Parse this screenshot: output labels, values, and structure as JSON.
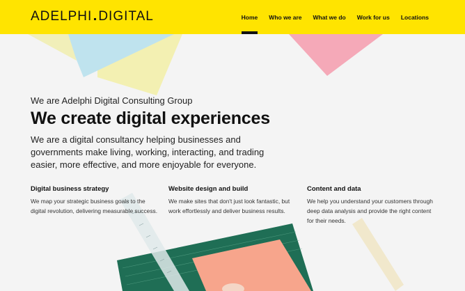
{
  "header": {
    "logo_left": "ADELPHI",
    "logo_right": "DIGITAL",
    "nav": [
      {
        "label": "Home",
        "active": true
      },
      {
        "label": "Who we are",
        "active": false
      },
      {
        "label": "What we do",
        "active": false
      },
      {
        "label": "Work for us",
        "active": false
      },
      {
        "label": "Locations",
        "active": false
      }
    ]
  },
  "hero": {
    "kicker": "We are Adelphi Digital Consulting Group",
    "title": "We create digital experiences",
    "lead": "We are a digital consultancy helping businesses and governments make living, working, interacting, and trading easier, more effective, and more enjoyable for everyone."
  },
  "services": [
    {
      "title": "Digital business strategy",
      "text": "We map your strategic business goals to the digital revolution, delivering measurable success."
    },
    {
      "title": "Website design and build",
      "text": "We make sites that don't just look fantastic, but work effortlessly and deliver business results."
    },
    {
      "title": "Content and data",
      "text": "We help you understand your customers through deep data analysis and provide the right content for their needs."
    }
  ],
  "colors": {
    "header": "#ffe400",
    "paper_blue": "#bfe3ee",
    "paper_yellow": "#f3f0b2",
    "paper_pink": "#f5a9b8",
    "mat_green": "#1f6e55",
    "paper_salmon": "#f7a58c",
    "ruler": "#dfe9ea",
    "bone_folder": "#f1e8cc"
  }
}
